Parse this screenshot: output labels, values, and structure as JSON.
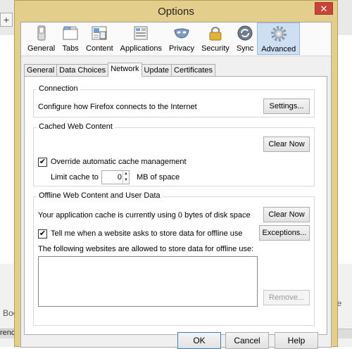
{
  "background": {
    "new_tab_symbol": "+",
    "left_fragment": "Boo",
    "right_fragment": "ore Pr",
    "bottom_fragment": "renc"
  },
  "window": {
    "title": "Options",
    "close_symbol": "✕"
  },
  "toolbar": {
    "items": [
      {
        "label": "General",
        "icon": "general-switch-icon"
      },
      {
        "label": "Tabs",
        "icon": "tabs-icon"
      },
      {
        "label": "Content",
        "icon": "content-icon"
      },
      {
        "label": "Applications",
        "icon": "applications-icon"
      },
      {
        "label": "Privacy",
        "icon": "privacy-mask-icon"
      },
      {
        "label": "Security",
        "icon": "security-lock-icon"
      },
      {
        "label": "Sync",
        "icon": "sync-icon"
      },
      {
        "label": "Advanced",
        "icon": "advanced-gear-icon"
      }
    ],
    "selected": "Advanced"
  },
  "tabs": {
    "items": [
      "General",
      "Data Choices",
      "Network",
      "Update",
      "Certificates"
    ],
    "selected": "Network"
  },
  "connection": {
    "title": "Connection",
    "description": "Configure how Firefox connects to the Internet",
    "settings_button": "Settings..."
  },
  "cache": {
    "title": "Cached Web Content",
    "clear_button": "Clear Now",
    "override_label": "Override automatic cache management",
    "override_checked": true,
    "limit_label": "Limit cache to",
    "limit_value": "0",
    "limit_unit": "MB of space"
  },
  "offline": {
    "title": "Offline Web Content and User Data",
    "usage_text": "Your application cache is currently using 0 bytes of disk space",
    "clear_button": "Clear Now",
    "tell_label": "Tell me when a website asks to store data for offline use",
    "tell_checked": true,
    "exceptions_button": "Exceptions...",
    "list_label": "The following websites are allowed to store data for offline use:",
    "remove_button": "Remove..."
  },
  "footer": {
    "ok": "OK",
    "cancel": "Cancel",
    "help": "Help"
  },
  "colors": {
    "window_frame": "#e3cf8b",
    "selected_toolbar": "#cfdff3",
    "close_button": "#c7443a"
  }
}
